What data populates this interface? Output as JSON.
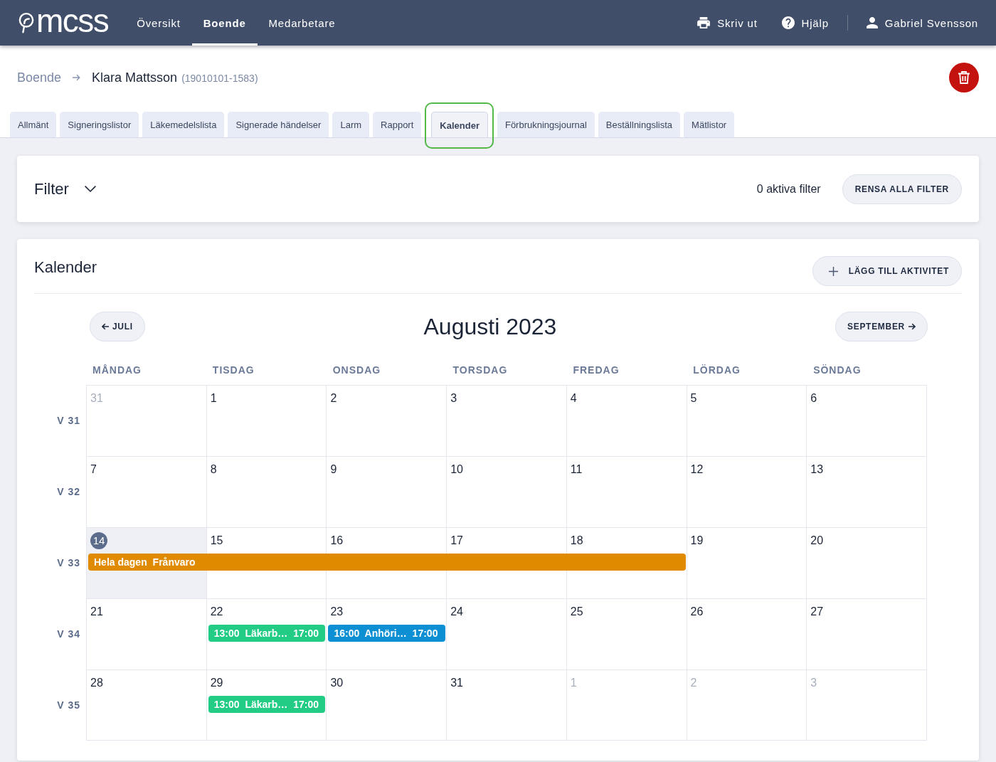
{
  "navbar": {
    "logo": "mcss",
    "links": [
      {
        "label": "Översikt",
        "selected": false
      },
      {
        "label": "Boende",
        "selected": true
      },
      {
        "label": "Medarbetare",
        "selected": false
      }
    ],
    "actions": [
      {
        "kind": "print",
        "label": "Skriv ut"
      },
      {
        "kind": "help",
        "label": "Hjälp"
      }
    ],
    "user": "Gabriel Svensson"
  },
  "breadcrumb": {
    "parent": "Boende",
    "current": "Klara Mattsson",
    "personal_number": "(19010101-1583)"
  },
  "tabs": [
    {
      "label": "Allmänt",
      "selected": false,
      "highlighted": false
    },
    {
      "label": "Signeringslistor",
      "selected": false,
      "highlighted": false
    },
    {
      "label": "Läkemedelslista",
      "selected": false,
      "highlighted": false
    },
    {
      "label": "Signerade händelser",
      "selected": false,
      "highlighted": false
    },
    {
      "label": "Larm",
      "selected": false,
      "highlighted": false
    },
    {
      "label": "Rapport",
      "selected": false,
      "highlighted": false
    },
    {
      "label": "Kalender",
      "selected": true,
      "highlighted": true
    },
    {
      "label": "Förbrukningsjournal",
      "selected": false,
      "highlighted": false
    },
    {
      "label": "Beställningslista",
      "selected": false,
      "highlighted": false
    },
    {
      "label": "Mätlistor",
      "selected": false,
      "highlighted": false
    }
  ],
  "filter": {
    "title": "Filter",
    "expanded": false,
    "active_count": "0 aktiva filter",
    "clear_button": "RENSA ALLA FILTER"
  },
  "calendar": {
    "title": "Kalender",
    "add_button": "LÄGG TILL AKTIVITET",
    "prev_month": "JULI",
    "month_title": "Augusti 2023",
    "next_month": "SEPTEMBER",
    "weekdays": [
      "MÅNDAG",
      "TISDAG",
      "ONSDAG",
      "TORSDAG",
      "FREDAG",
      "LÖRDAG",
      "SÖNDAG"
    ],
    "weeks": [
      {
        "label": "V 31",
        "days": [
          {
            "date": "31",
            "outside": true,
            "today": false
          },
          {
            "date": "1",
            "outside": false,
            "today": false
          },
          {
            "date": "2",
            "outside": false,
            "today": false
          },
          {
            "date": "3",
            "outside": false,
            "today": false
          },
          {
            "date": "4",
            "outside": false,
            "today": false
          },
          {
            "date": "5",
            "outside": false,
            "today": false
          },
          {
            "date": "6",
            "outside": false,
            "today": false
          }
        ]
      },
      {
        "label": "V 32",
        "days": [
          {
            "date": "7",
            "outside": false,
            "today": false
          },
          {
            "date": "8",
            "outside": false,
            "today": false
          },
          {
            "date": "9",
            "outside": false,
            "today": false
          },
          {
            "date": "10",
            "outside": false,
            "today": false
          },
          {
            "date": "11",
            "outside": false,
            "today": false
          },
          {
            "date": "12",
            "outside": false,
            "today": false
          },
          {
            "date": "13",
            "outside": false,
            "today": false
          }
        ]
      },
      {
        "label": "V 33",
        "banner": {
          "label": "Hela dagen",
          "title": "Frånvaro",
          "color": "#e08a00"
        },
        "days": [
          {
            "date": "14",
            "outside": false,
            "today": true,
            "covered": true
          },
          {
            "date": "15",
            "outside": false,
            "today": false,
            "covered": true
          },
          {
            "date": "16",
            "outside": false,
            "today": false,
            "covered": true
          },
          {
            "date": "17",
            "outside": false,
            "today": false,
            "covered": true
          },
          {
            "date": "18",
            "outside": false,
            "today": false,
            "covered": true
          },
          {
            "date": "19",
            "outside": false,
            "today": false,
            "covered": false
          },
          {
            "date": "20",
            "outside": false,
            "today": false,
            "covered": false
          }
        ]
      },
      {
        "label": "V 34",
        "days": [
          {
            "date": "21",
            "outside": false,
            "today": false
          },
          {
            "date": "22",
            "outside": false,
            "today": false,
            "events": [
              {
                "start": "13:00",
                "title": "Läkarb…",
                "end": "17:00",
                "color": "#22cc85"
              }
            ]
          },
          {
            "date": "23",
            "outside": false,
            "today": false,
            "events": [
              {
                "start": "16:00",
                "title": "Anhöri…",
                "end": "17:00",
                "color": "#0d8fd4"
              }
            ]
          },
          {
            "date": "24",
            "outside": false,
            "today": false
          },
          {
            "date": "25",
            "outside": false,
            "today": false
          },
          {
            "date": "26",
            "outside": false,
            "today": false
          },
          {
            "date": "27",
            "outside": false,
            "today": false
          }
        ]
      },
      {
        "label": "V 35",
        "days": [
          {
            "date": "28",
            "outside": false,
            "today": false
          },
          {
            "date": "29",
            "outside": false,
            "today": false,
            "events": [
              {
                "start": "13:00",
                "title": "Läkarb…",
                "end": "17:00",
                "color": "#22cc85"
              }
            ]
          },
          {
            "date": "30",
            "outside": false,
            "today": false
          },
          {
            "date": "31",
            "outside": false,
            "today": false
          },
          {
            "date": "1",
            "outside": true,
            "today": false
          },
          {
            "date": "2",
            "outside": true,
            "today": false
          },
          {
            "date": "3",
            "outside": true,
            "today": false
          }
        ]
      }
    ]
  }
}
